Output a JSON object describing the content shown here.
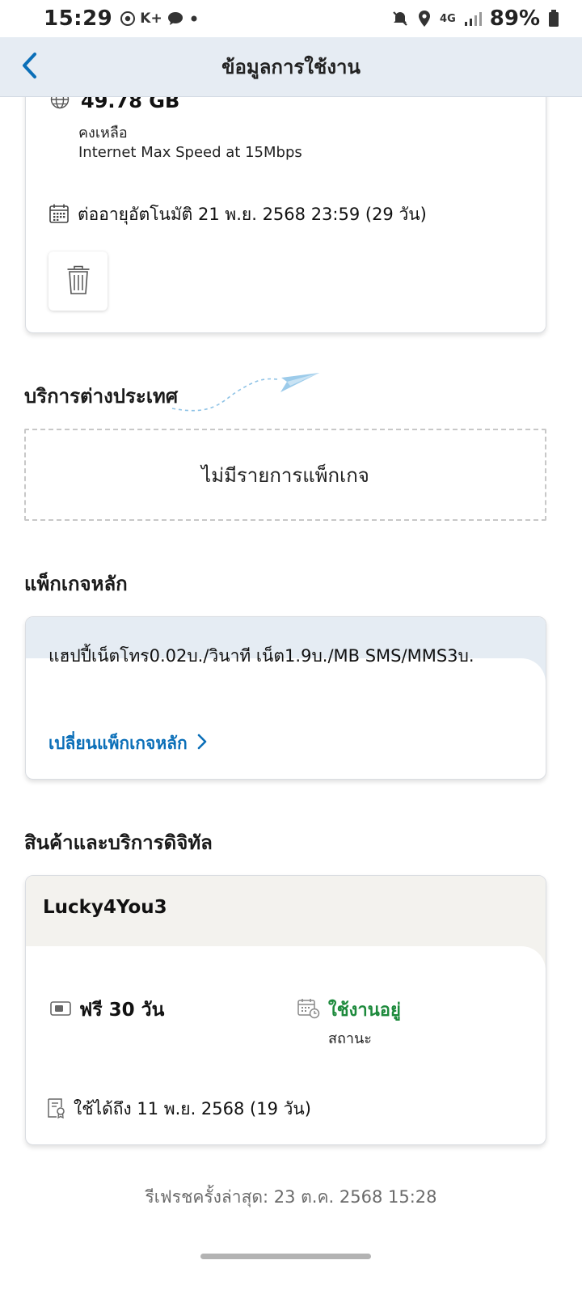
{
  "status_bar": {
    "time": "15:29",
    "battery": "89%",
    "icons": [
      "chrome-icon",
      "k-plus-icon",
      "chat-icon",
      "dot-icon",
      "mute-icon",
      "location-icon",
      "4g-icon",
      "signal-icon",
      "battery-icon"
    ],
    "k_plus_text": "K+",
    "network_text": "4G"
  },
  "header": {
    "title": "ข้อมูลการใช้งาน"
  },
  "data_card": {
    "amount": "49.78 GB",
    "remaining_label": "คงเหลือ",
    "speed_note": "Internet Max Speed at 15Mbps",
    "renew_text": "ต่ออายุอัตโนมัติ 21 พ.ย. 2568 23:59 (29 วัน)"
  },
  "roaming": {
    "title": "บริการต่างประเทศ",
    "empty_text": "ไม่มีรายการแพ็กเกจ"
  },
  "main_package": {
    "title": "แพ็กเกจหลัก",
    "name": "แฮปปี้เน็ตโทร0.02บ./วินาที เน็ต1.9บ./MB SMS/MMS3บ.",
    "change_label": "เปลี่ยนแพ็กเกจหลัก"
  },
  "digital": {
    "title": "สินค้าและบริการดิจิทัล",
    "name": "Lucky4You3",
    "free_text": "ฟรี 30 วัน",
    "status_value": "ใช้งานอยู่",
    "status_label": "สถานะ",
    "valid_until": "ใช้ได้ถึง 11 พ.ย. 2568 (19 วัน)"
  },
  "footer": {
    "refresh_text": "รีเฟรชครั้งล่าสุด: 23 ต.ค. 2568 15:28"
  },
  "colors": {
    "header_bg": "#e6ecf3",
    "link_blue": "#0b6fb8",
    "active_green": "#1d8a3c",
    "digital_head_bg": "#f3f2ee"
  }
}
